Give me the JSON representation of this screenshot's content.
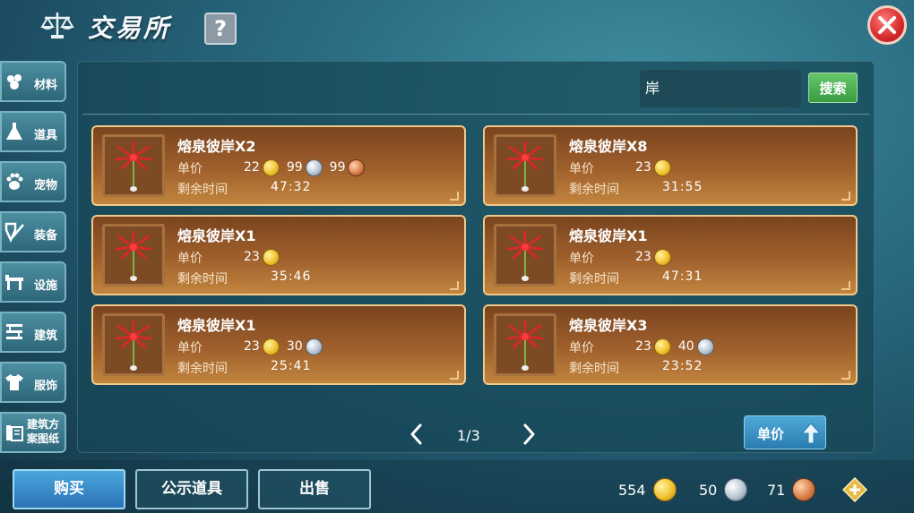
{
  "header": {
    "title": "交易所",
    "help_label": "?"
  },
  "sidebar": {
    "items": [
      {
        "label": "材料",
        "icon": "materials-icon"
      },
      {
        "label": "道具",
        "icon": "item-flask-icon"
      },
      {
        "label": "宠物",
        "icon": "paw-icon"
      },
      {
        "label": "装备",
        "icon": "equipment-icon"
      },
      {
        "label": "设施",
        "icon": "facility-icon"
      },
      {
        "label": "建筑",
        "icon": "building-icon"
      },
      {
        "label": "服饰",
        "icon": "clothing-icon"
      },
      {
        "label": "建筑方案图纸",
        "icon": "blueprint-icon"
      }
    ]
  },
  "search": {
    "value": "岸",
    "button_label": "搜索"
  },
  "listing_labels": {
    "price": "单价",
    "time": "剩余时间"
  },
  "listings": [
    {
      "name": "熔泉彼岸X2",
      "price": {
        "gold": "22",
        "silver": "99",
        "copper": "99"
      },
      "time": "47:32"
    },
    {
      "name": "熔泉彼岸X8",
      "price": {
        "gold": "23"
      },
      "time": "31:55"
    },
    {
      "name": "熔泉彼岸X1",
      "price": {
        "gold": "23"
      },
      "time": "35:46"
    },
    {
      "name": "熔泉彼岸X1",
      "price": {
        "gold": "23"
      },
      "time": "47:31"
    },
    {
      "name": "熔泉彼岸X1",
      "price": {
        "gold": "23",
        "silver": "30"
      },
      "time": "25:41"
    },
    {
      "name": "熔泉彼岸X3",
      "price": {
        "gold": "23",
        "silver": "40"
      },
      "time": "23:52"
    }
  ],
  "pagination": {
    "text": "1/3"
  },
  "sort": {
    "label": "单价"
  },
  "tabs": {
    "buy": "购买",
    "public": "公示道具",
    "sell": "出售"
  },
  "wallet": {
    "gold": "554",
    "silver": "50",
    "copper": "71"
  },
  "colors": {
    "card_border": "#f0c98a",
    "accent_blue": "#2a7cb0",
    "close_red": "#d52a2a",
    "search_green": "#3a9a40"
  }
}
